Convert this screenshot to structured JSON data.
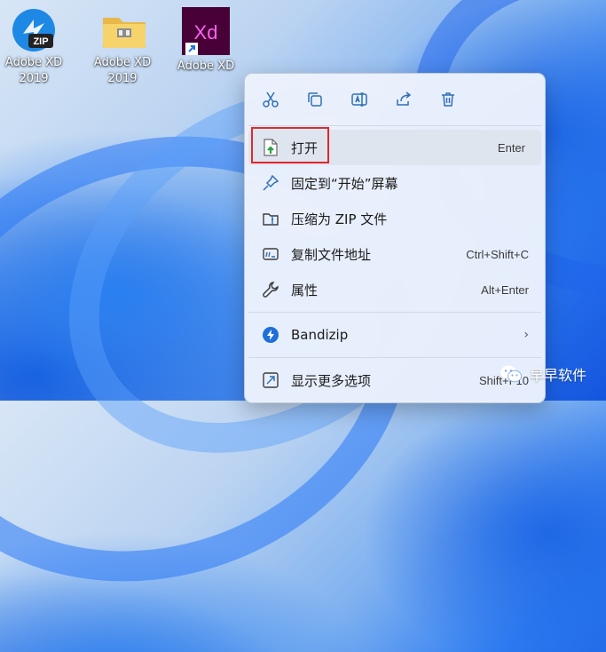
{
  "desktop": {
    "icons": [
      {
        "label": "Adobe XD\n2019",
        "type": "zip"
      },
      {
        "label": "Adobe XD\n2019",
        "type": "folder"
      },
      {
        "label": "Adobe XD",
        "type": "xd-shortcut"
      }
    ],
    "zip_badge": "ZIP",
    "xd_badge": "Xd"
  },
  "context_menu": {
    "toolbar": [
      "cut-icon",
      "copy-icon",
      "rename-icon",
      "share-icon",
      "delete-icon"
    ],
    "items": [
      {
        "label": "打开",
        "shortcut": "Enter",
        "icon": "open-file-icon"
      },
      {
        "label": "固定到“开始”屏幕",
        "shortcut": "",
        "icon": "pin-icon"
      },
      {
        "label": "压缩为 ZIP 文件",
        "shortcut": "",
        "icon": "zip-folder-icon"
      },
      {
        "label": "复制文件地址",
        "shortcut": "Ctrl+Shift+C",
        "icon": "copy-path-icon"
      },
      {
        "label": "属性",
        "shortcut": "Alt+Enter",
        "icon": "wrench-icon"
      },
      {
        "label": "Bandizip",
        "shortcut": "",
        "icon": "bandizip-icon"
      },
      {
        "label": "显示更多选项",
        "shortcut": "Shift+F10",
        "icon": "more-options-icon"
      }
    ]
  },
  "watermark": {
    "text": "早早软件"
  },
  "colors": {
    "accent": "#e2262d",
    "xd_bg": "#470137",
    "xd_text": "#ff61f6"
  }
}
